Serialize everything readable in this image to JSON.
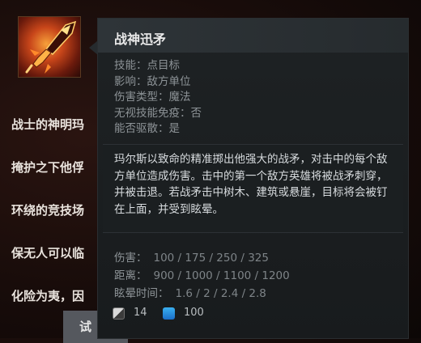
{
  "lore_lines": [
    "战士的神明玛",
    "掩护之下他俘",
    "环绕的竞技场",
    "保无人可以临",
    "化险为夷，因"
  ],
  "try_button_label": "试",
  "ability": {
    "icon": "spear-icon",
    "name": "战神迅矛",
    "properties": [
      "技能：点目标",
      "影响：敌方单位",
      "伤害类型：魔法",
      "无视技能免疫：否",
      "能否驱散：是"
    ],
    "description": "玛尔斯以致命的精准掷出他强大的战矛，对击中的每个敌方单位造成伤害。击中的第一个敌方英雄将被战矛刺穿，并被击退。若战矛击中树木、建筑或悬崖，目标将会被钉在上面，并受到眩晕。",
    "stats": [
      {
        "label": "伤害：",
        "value": "100 / 175 / 250 / 325"
      },
      {
        "label": "距离：",
        "value": "900 / 1000 / 1100 / 1200"
      },
      {
        "label": "眩晕时间：",
        "value": "1.6 / 2 / 2.4 / 2.8"
      }
    ],
    "cooldown": "14",
    "mana_cost": "100"
  },
  "colors": {
    "mana_blue": "#2a90e0",
    "tooltip_bg": "#1e2224"
  }
}
